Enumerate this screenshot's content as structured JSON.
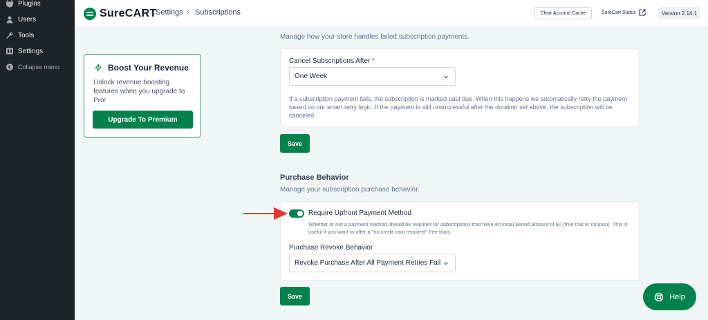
{
  "wp_menu": [
    {
      "label": "Plugins",
      "icon": "plugin-icon"
    },
    {
      "label": "Users",
      "icon": "users-icon"
    },
    {
      "label": "Tools",
      "icon": "wrench-icon"
    },
    {
      "label": "Settings",
      "icon": "settings-icon"
    },
    {
      "label": "Collapse menu",
      "icon": "collapse-icon"
    }
  ],
  "header": {
    "logo_text": "SureCART",
    "breadcrumb": [
      "Settings",
      "Subscriptions"
    ],
    "clear_cache": "Clear Account Cache",
    "status": "SureCart Status",
    "version": "Version 2.14.1"
  },
  "promo": {
    "title": "Boost Your Revenue",
    "description": "Unlock revenue boosting features when you upgrade to Pro!",
    "button": "Upgrade To Premium"
  },
  "failed_payments": {
    "description": "Manage how your store handles failed subscription payments.",
    "field_label": "Cancel Subscriptions After",
    "required_mark": "*",
    "value": "One Week",
    "help": "If a subscription payment fails, the subscription is marked past due. When this happens we automatically retry the payment based on our smart retry logic. If the payment is still unsuccessful after the duration set above, the subscription will be canceled.",
    "save": "Save"
  },
  "purchase_behavior": {
    "title": "Purchase Behavior",
    "description": "Manage your subscription purchase behavior.",
    "toggle_label": "Require Upfront Payment Method",
    "toggle_help": "Whether or not a payment method should be required for subscriptions that have an initial period amount of $0 (free trial or coupon). This is useful if you want to offer a \"no credit card required\" free trials.",
    "toggle_on": true,
    "revoke_label": "Purchase Revoke Behavior",
    "revoke_value": "Revoke Purchase After All Payment Retries Fail",
    "save": "Save"
  },
  "help_button": "Help",
  "colors": {
    "brand": "#01824c",
    "annotation_arrow": "#e53935",
    "sidebar": "#1d2327"
  }
}
